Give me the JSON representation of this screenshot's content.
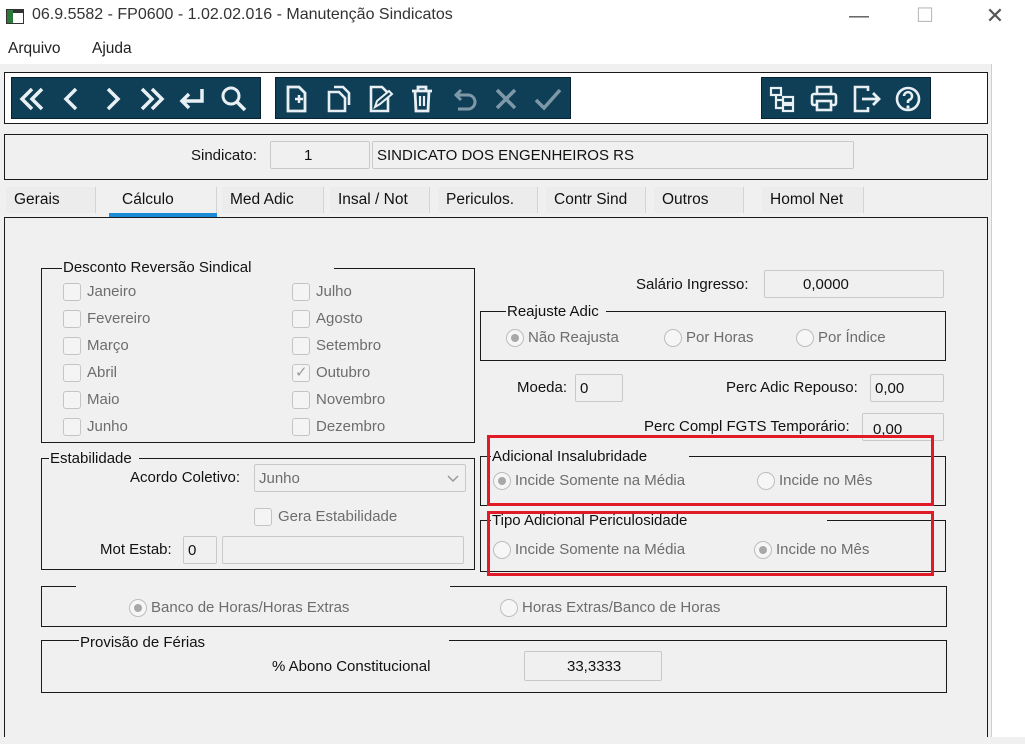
{
  "window": {
    "title": "06.9.5582 - FP0600 - 1.02.02.016 - Manutenção Sindicatos"
  },
  "menu": {
    "items": [
      "Arquivo",
      "Ajuda"
    ]
  },
  "toolbar": {
    "nav_icons": [
      "first-icon",
      "previous-icon",
      "next-icon",
      "last-icon",
      "return-icon",
      "search-icon"
    ],
    "edit_icons": [
      "new-record-icon",
      "copy-record-icon",
      "edit-record-icon",
      "delete-icon",
      "undo-icon",
      "cancel-icon",
      "confirm-icon"
    ],
    "util_icons": [
      "tree-icon",
      "print-icon",
      "exit-icon",
      "help-icon"
    ]
  },
  "sindicato": {
    "label": "Sindicato:",
    "code": "1",
    "name": "SINDICATO DOS ENGENHEIROS RS"
  },
  "tabs": [
    "Gerais",
    "Cálculo",
    "Med Adic",
    "Insal / Not",
    "Periculos.",
    "Contr Sind",
    "Outros",
    "Homol Net"
  ],
  "active_tab": "Cálculo",
  "desconto": {
    "title": "Desconto Reversão Sindical",
    "months_left": [
      "Janeiro",
      "Fevereiro",
      "Março",
      "Abril",
      "Maio",
      "Junho"
    ],
    "months_right": [
      "Julho",
      "Agosto",
      "Setembro",
      "Outubro",
      "Novembro",
      "Dezembro"
    ],
    "checked": "Outubro"
  },
  "salario": {
    "label": "Salário Ingresso:",
    "value": "0,0000"
  },
  "reajuste": {
    "title": "Reajuste Adic",
    "options": [
      "Não Reajusta",
      "Por Horas",
      "Por Índice"
    ],
    "selected": "Não Reajusta"
  },
  "moeda": {
    "label": "Moeda:",
    "value": "0"
  },
  "perc_adic_repouso": {
    "label": "Perc Adic Repouso:",
    "value": "0,00"
  },
  "perc_fgts": {
    "label": "Perc Compl FGTS Temporário:",
    "value": "0,00"
  },
  "estabilidade": {
    "title": "Estabilidade",
    "acordo_label": "Acordo Coletivo:",
    "acordo_value": "Junho",
    "gera_label": "Gera Estabilidade",
    "mot_label": "Mot Estab:",
    "mot_value": "0",
    "mot_desc": ""
  },
  "insalubridade": {
    "title": "Adicional Insalubridade",
    "options": [
      "Incide Somente na Média",
      "Incide no Mês"
    ],
    "selected": "Incide Somente na Média"
  },
  "periculosidade": {
    "title": "Tipo Adicional Periculosidade",
    "options": [
      "Incide Somente na Média",
      "Incide no Mês"
    ],
    "selected": "Incide no Mês"
  },
  "banco_horas": {
    "options": [
      "Banco de Horas/Horas Extras",
      "Horas Extras/Banco de Horas"
    ],
    "selected": "Banco de Horas/Horas Extras"
  },
  "ferias": {
    "title": "Provisão de Férias",
    "label": "% Abono Constitucional",
    "value": "33,3333"
  },
  "colors": {
    "toolbar_bg": "#0f3e57",
    "highlight": "#e01a26",
    "tab_accent": "#1a8cd8"
  }
}
